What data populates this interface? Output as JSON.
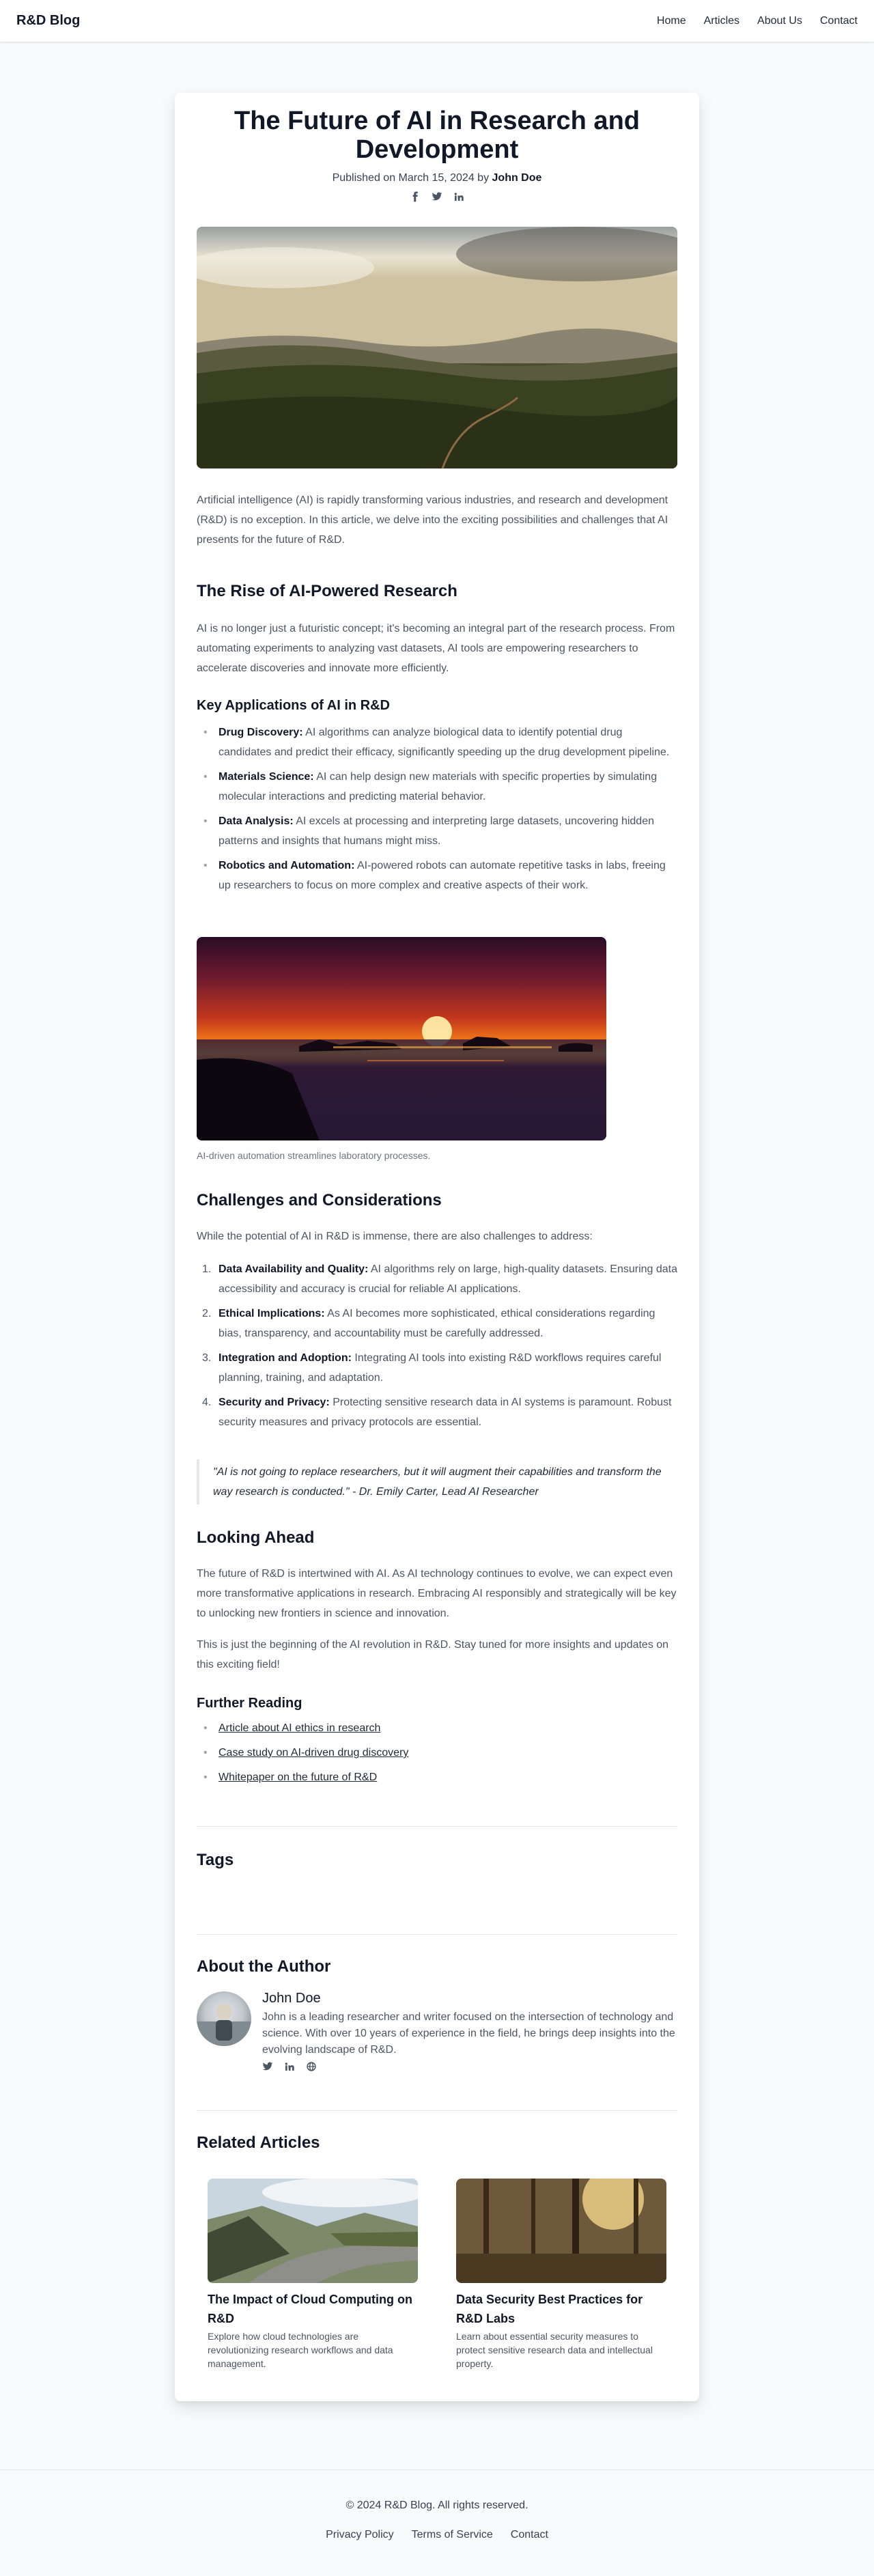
{
  "header": {
    "brand": "R&D Blog",
    "nav": [
      "Home",
      "Articles",
      "About Us",
      "Contact"
    ]
  },
  "article": {
    "title": "The Future of AI in Research and Development",
    "published_prefix": "Published on March 15, 2024 by ",
    "author": "John Doe",
    "share_icons": [
      "facebook-icon",
      "twitter-icon",
      "linkedin-icon"
    ],
    "intro": "Artificial intelligence (AI) is rapidly transforming various industries, and research and development (R&D) is no exception. In this article, we delve into the exciting possibilities and challenges that AI presents for the future of R&D.",
    "rise": {
      "heading": "The Rise of AI-Powered Research",
      "text": "AI is no longer just a futuristic concept; it's becoming an integral part of the research process. From automating experiments to analyzing vast datasets, AI tools are empowering researchers to accelerate discoveries and innovate more efficiently."
    },
    "applications": {
      "heading": "Key Applications of AI in R&D",
      "items": [
        {
          "label": "Drug Discovery:",
          "text": " AI algorithms can analyze biological data to identify potential drug candidates and predict their efficacy, significantly speeding up the drug development pipeline."
        },
        {
          "label": "Materials Science:",
          "text": " AI can help design new materials with specific properties by simulating molecular interactions and predicting material behavior."
        },
        {
          "label": "Data Analysis:",
          "text": " AI excels at processing and interpreting large datasets, uncovering hidden patterns and insights that humans might miss."
        },
        {
          "label": "Robotics and Automation:",
          "text": " AI-powered robots can automate repetitive tasks in labs, freeing up researchers to focus on more complex and creative aspects of their work."
        }
      ]
    },
    "figure_caption": "AI-driven automation streamlines laboratory processes.",
    "challenges": {
      "heading": "Challenges and Considerations",
      "intro": "While the potential of AI in R&D is immense, there are also challenges to address:",
      "items": [
        {
          "num": "1.",
          "label": "Data Availability and Quality:",
          "text": " AI algorithms rely on large, high-quality datasets. Ensuring data accessibility and accuracy is crucial for reliable AI applications."
        },
        {
          "num": "2.",
          "label": "Ethical Implications:",
          "text": " As AI becomes more sophisticated, ethical considerations regarding bias, transparency, and accountability must be carefully addressed."
        },
        {
          "num": "3.",
          "label": "Integration and Adoption:",
          "text": " Integrating AI tools into existing R&D workflows requires careful planning, training, and adaptation."
        },
        {
          "num": "4.",
          "label": "Security and Privacy:",
          "text": " Protecting sensitive research data in AI systems is paramount. Robust security measures and privacy protocols are essential."
        }
      ],
      "quote": "\"AI is not going to replace researchers, but it will augment their capabilities and transform the way research is conducted.\" - Dr. Emily Carter, Lead AI Researcher"
    },
    "looking_ahead": {
      "heading": "Looking Ahead",
      "p1": "The future of R&D is intertwined with AI. As AI technology continues to evolve, we can expect even more transformative applications in research. Embracing AI responsibly and strategically will be key to unlocking new frontiers in science and innovation.",
      "p2": "This is just the beginning of the AI revolution in R&D. Stay tuned for more insights and updates on this exciting field!"
    },
    "further_reading": {
      "heading": "Further Reading",
      "links": [
        "Article about AI ethics in research",
        "Case study on AI-driven drug discovery",
        "Whitepaper on the future of R&D"
      ]
    },
    "tags_heading": "Tags",
    "author_box": {
      "heading": "About the Author",
      "name": "John Doe",
      "bio": "John is a leading researcher and writer focused on the intersection of technology and science. With over 10 years of experience in the field, he brings deep insights into the evolving landscape of R&D.",
      "links": [
        "twitter-icon",
        "linkedin-icon",
        "globe-icon"
      ]
    },
    "related": {
      "heading": "Related Articles",
      "items": [
        {
          "title": "The Impact of Cloud Computing on R&D",
          "desc": "Explore how cloud technologies are revolutionizing research workflows and data management."
        },
        {
          "title": "Data Security Best Practices for R&D Labs",
          "desc": "Learn about essential security measures to protect sensitive research data and intellectual property."
        }
      ]
    }
  },
  "footer": {
    "copyright": "© 2024 R&D Blog. All rights reserved.",
    "links": [
      "Privacy Policy",
      "Terms of Service",
      "Contact"
    ]
  }
}
